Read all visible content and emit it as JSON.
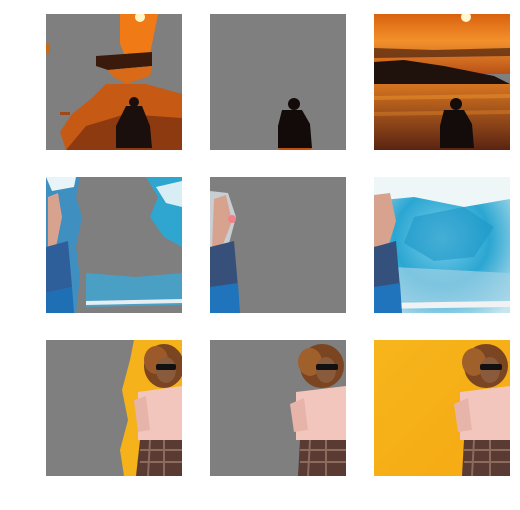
{
  "figure": {
    "rows": 3,
    "cols": 3,
    "background": "#ffffff",
    "mask_fill": "#7f7f7f",
    "panels": [
      {
        "row": 1,
        "col": 1,
        "scene": "sunset-lake",
        "mode": "background-region-masked"
      },
      {
        "row": 1,
        "col": 2,
        "scene": "sunset-lake",
        "mode": "person-only"
      },
      {
        "row": 1,
        "col": 3,
        "scene": "sunset-lake",
        "mode": "full-image"
      },
      {
        "row": 2,
        "col": 1,
        "scene": "blue-smoke-person",
        "mode": "partial-region-masked"
      },
      {
        "row": 2,
        "col": 2,
        "scene": "blue-smoke-person",
        "mode": "person-only"
      },
      {
        "row": 2,
        "col": 3,
        "scene": "blue-smoke-person",
        "mode": "full-image"
      },
      {
        "row": 3,
        "col": 1,
        "scene": "woman-yellow-wall",
        "mode": "partial-region-masked"
      },
      {
        "row": 3,
        "col": 2,
        "scene": "woman-yellow-wall",
        "mode": "person-only"
      },
      {
        "row": 3,
        "col": 3,
        "scene": "woman-yellow-wall",
        "mode": "full-image"
      }
    ]
  }
}
